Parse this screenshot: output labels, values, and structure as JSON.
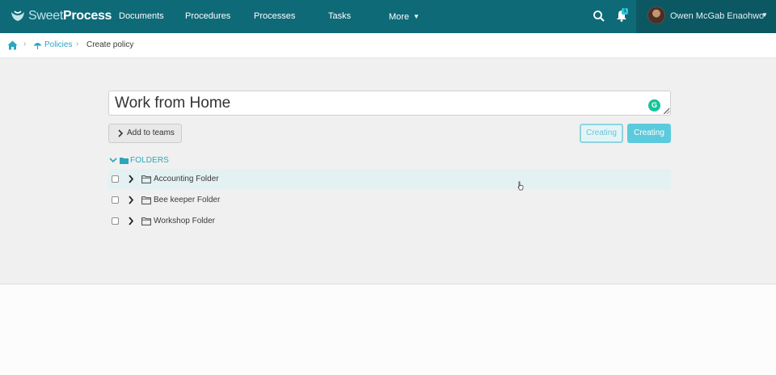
{
  "brand": {
    "name_light": "Sweet",
    "name_bold": "Process"
  },
  "nav": {
    "items": [
      {
        "label": "Documents"
      },
      {
        "label": "Procedures"
      },
      {
        "label": "Processes"
      },
      {
        "label": "Tasks"
      },
      {
        "label": "More"
      }
    ]
  },
  "notifications": {
    "badge": "1"
  },
  "user": {
    "name": "Owen McGab Enaohwo"
  },
  "breadcrumb": {
    "policies": "Policies",
    "current": "Create policy"
  },
  "editor": {
    "title_value": "Work from Home",
    "grammarly_letter": "G"
  },
  "actions": {
    "add_to_teams": "Add to teams",
    "creating_outline": "Creating",
    "creating": "Creating"
  },
  "folders": {
    "heading": "FOLDERS",
    "items": [
      {
        "label": "Accounting Folder"
      },
      {
        "label": "Bee keeper Folder"
      },
      {
        "label": "Workshop Folder"
      }
    ]
  },
  "colors": {
    "nav_bg": "#0f6a78",
    "user_bg": "#0b5863",
    "accent": "#2aa7bd",
    "button_primary": "#5ccadd"
  }
}
